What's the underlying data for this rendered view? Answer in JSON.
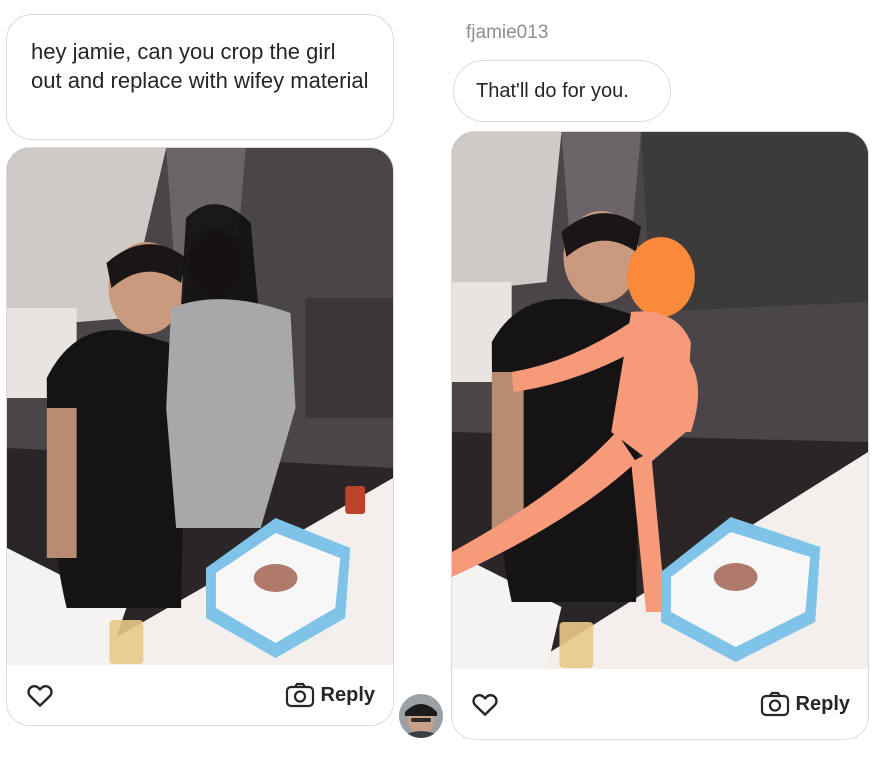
{
  "conversation": {
    "sent_message": "hey jamie, can you crop the girl out and replace with wifey material",
    "reply_username": "fjamie013",
    "reply_message": "That'll do for you."
  },
  "left_post": {
    "reply_label": "Reply",
    "heart_icon": "heart-outline-icon",
    "camera_icon": "camera-icon"
  },
  "right_post": {
    "reply_label": "Reply",
    "heart_icon": "heart-outline-icon",
    "camera_icon": "camera-icon"
  },
  "colors": {
    "bubble_border": "#dbdbdb",
    "text": "#262626",
    "muted": "#8e8e8e",
    "cake_frosting": "#7fc4e8",
    "inflatable": "#f79a7a"
  }
}
